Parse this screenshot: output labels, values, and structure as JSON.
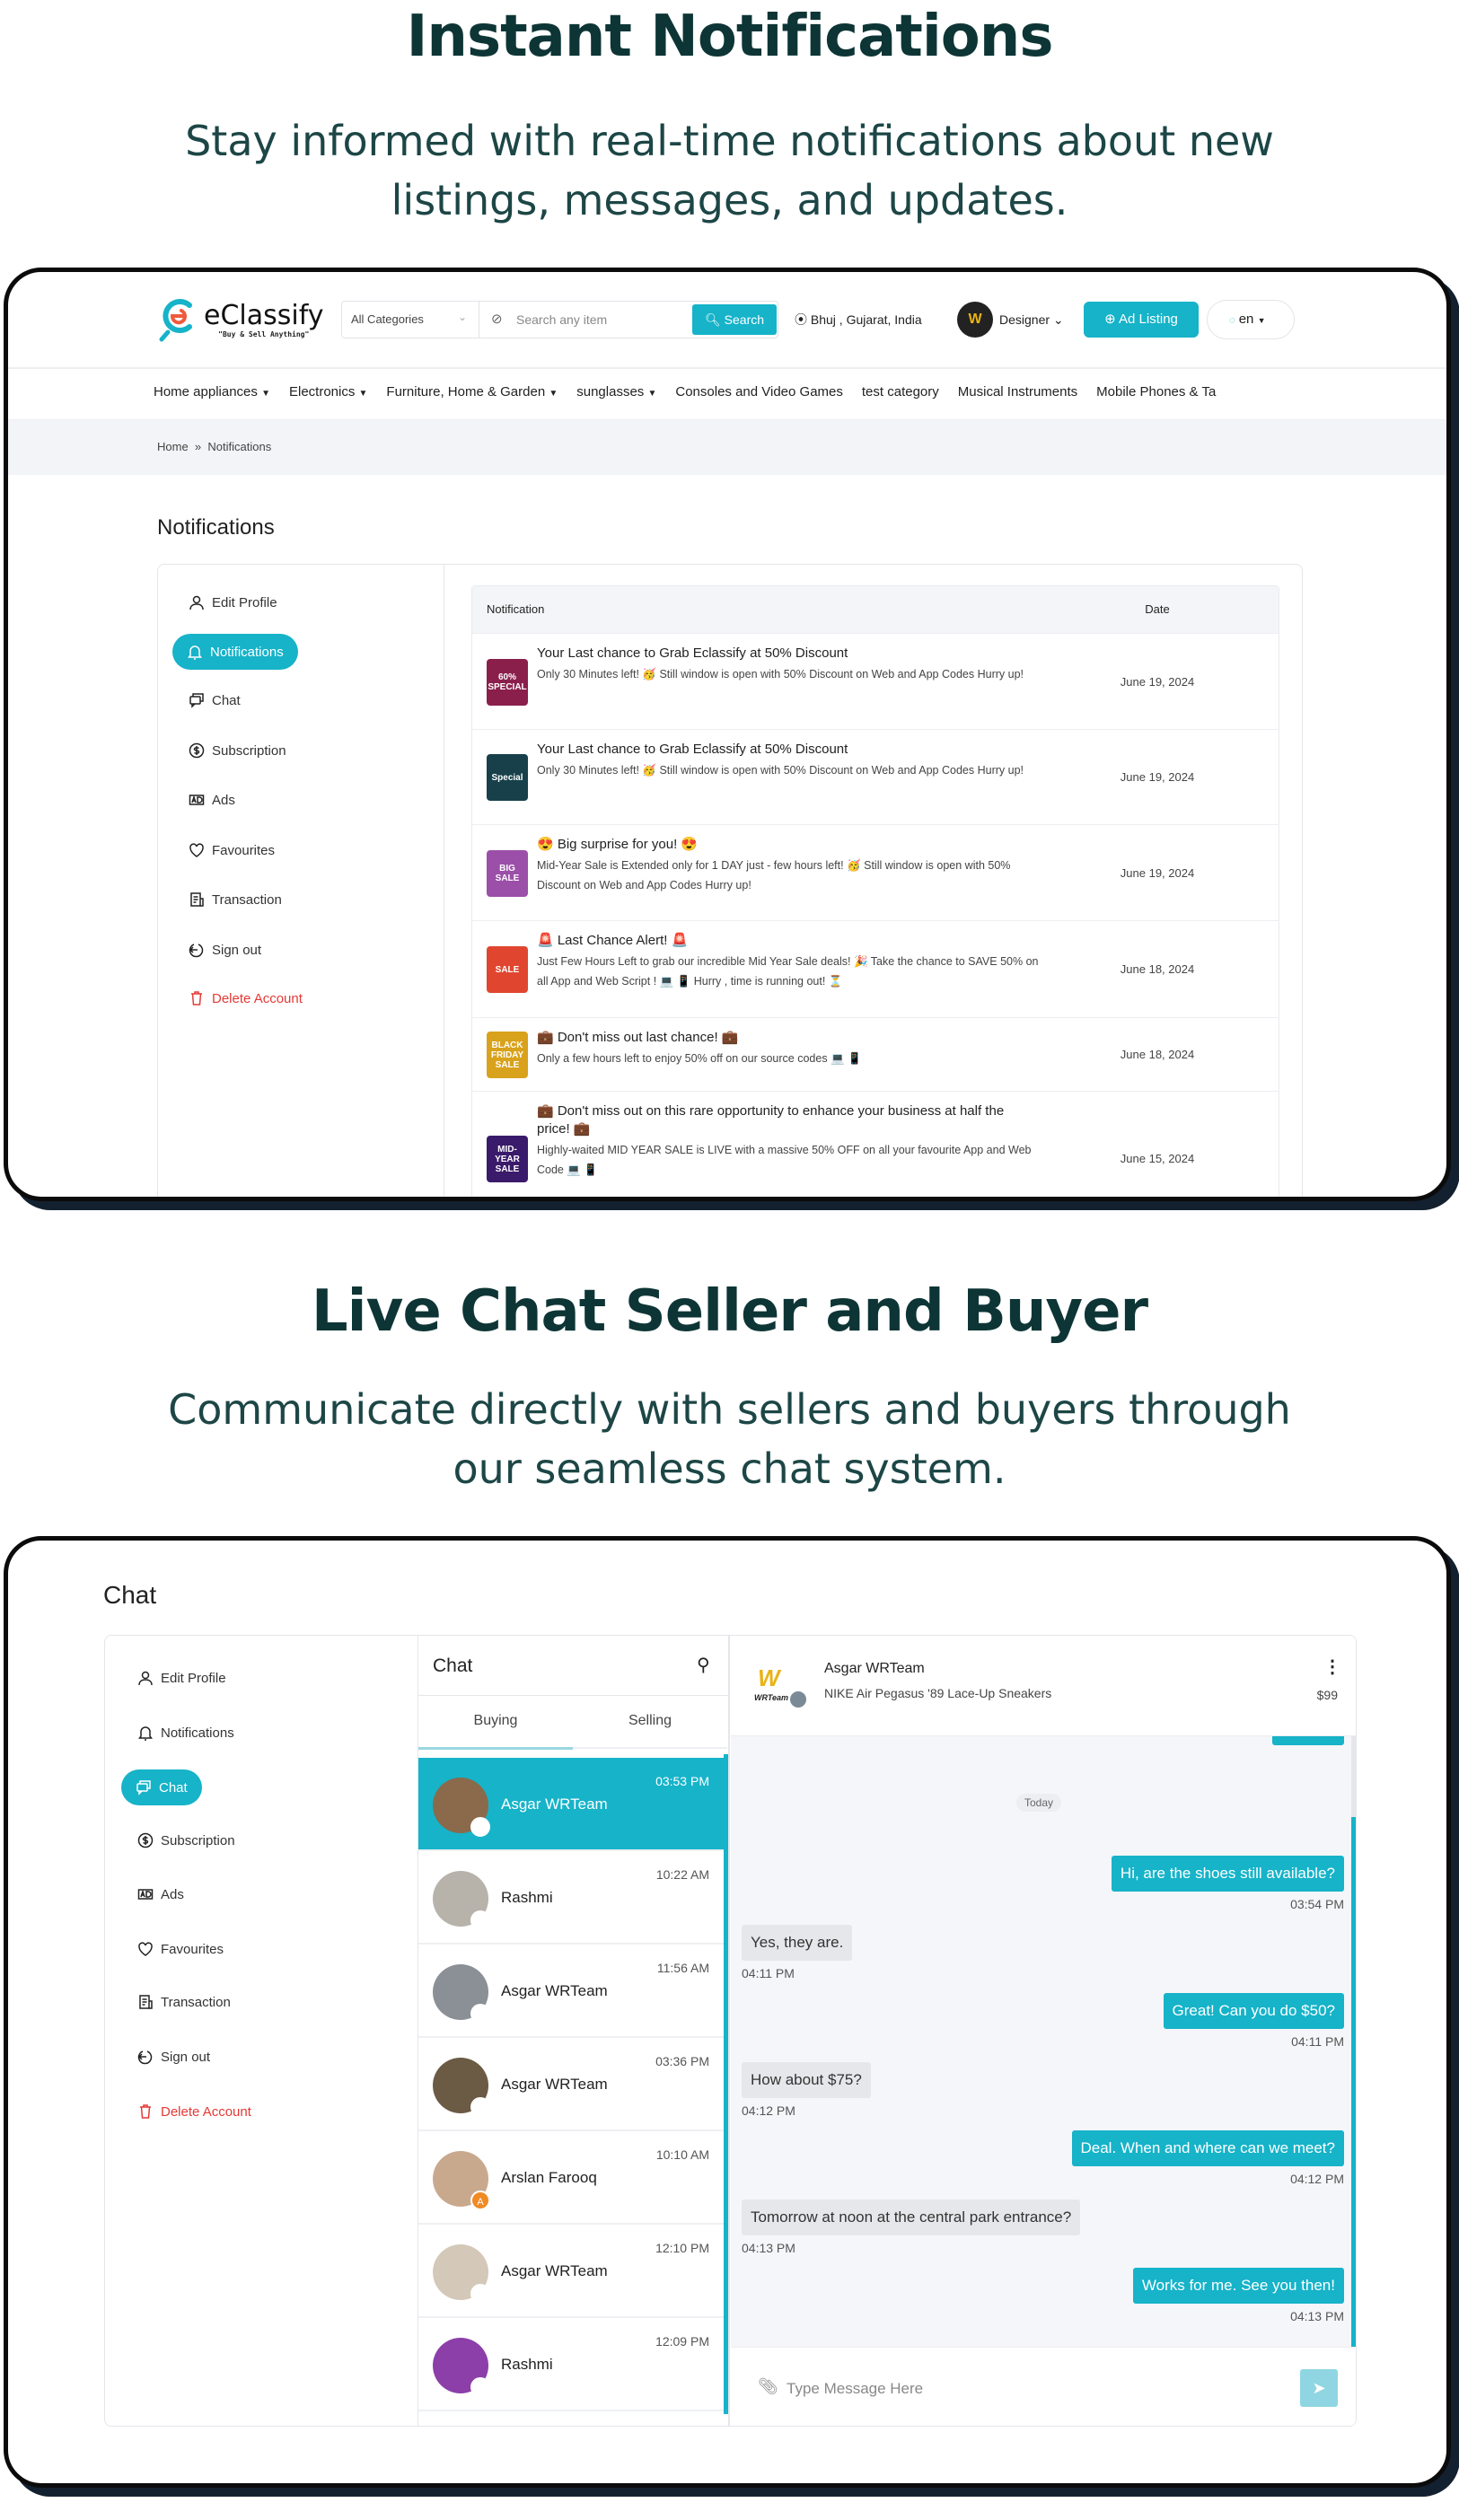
{
  "colors": {
    "accent": "#16b3c9",
    "heading": "#0e3535",
    "danger": "#e53935"
  },
  "section1": {
    "title": "Instant Notifications",
    "subtitle_line1": "Stay informed with real-time notifications about new",
    "subtitle_line2": "listings, messages, and updates."
  },
  "header": {
    "logo_name": "eClassify",
    "logo_tagline": "\"Buy & Sell Anything\"",
    "category_select": "All Categories",
    "search_placeholder": "Search any item",
    "search_button": "Search",
    "location": "Bhuj , Gujarat, India",
    "user_name": "Designer",
    "ad_listing": "Ad Listing",
    "language": "en"
  },
  "nav": [
    "Home appliances",
    "Electronics",
    "Furniture, Home & Garden",
    "sunglasses",
    "Consoles and Video Games",
    "test category",
    "Musical Instruments",
    "Mobile Phones & Ta"
  ],
  "nav_dropdown": [
    true,
    true,
    true,
    true,
    false,
    false,
    false,
    false
  ],
  "breadcrumb": {
    "home": "Home",
    "sep": "»",
    "current": "Notifications"
  },
  "notif_page": {
    "title": "Notifications"
  },
  "sidebar": [
    {
      "label": "Edit Profile",
      "icon": "user-icon"
    },
    {
      "label": "Notifications",
      "icon": "bell-icon"
    },
    {
      "label": "Chat",
      "icon": "chat-icon"
    },
    {
      "label": "Subscription",
      "icon": "dollar-icon"
    },
    {
      "label": "Ads",
      "icon": "ads-icon"
    },
    {
      "label": "Favourites",
      "icon": "heart-icon"
    },
    {
      "label": "Transaction",
      "icon": "receipt-icon"
    },
    {
      "label": "Sign out",
      "icon": "signout-icon"
    },
    {
      "label": "Delete Account",
      "icon": "trash-icon"
    }
  ],
  "table": {
    "col_notification": "Notification",
    "col_date": "Date",
    "rows": [
      {
        "thumb_text": "60% SPECIAL",
        "thumb_color": "#8a1f4c",
        "title": "Your Last chance to Grab Eclassify at 50% Discount",
        "body": "Only 30 Minutes left! 🥳 Still window is open with 50% Discount on Web and App Codes Hurry up!",
        "date": "June 19, 2024"
      },
      {
        "thumb_text": "Special",
        "thumb_color": "#17404a",
        "title": "Your Last chance to Grab Eclassify at 50% Discount",
        "body": "Only 30 Minutes left! 🥳 Still window is open with 50% Discount on Web and App Codes Hurry up!",
        "date": "June 19, 2024"
      },
      {
        "thumb_text": "BIG SALE",
        "thumb_color": "#9b4fa8",
        "title": "😍 Big surprise for you! 😍",
        "body": "Mid-Year Sale is Extended only for 1 DAY just - few hours left! 🥳 Still window is open with 50% Discount on Web and App Codes Hurry up!",
        "date": "June 19, 2024"
      },
      {
        "thumb_text": "SALE",
        "thumb_color": "#e0462f",
        "title": "🚨 Last Chance Alert! 🚨",
        "body": "Just Few Hours Left to grab our incredible Mid Year Sale deals! 🎉 Take the chance to SAVE 50% on all App and Web Script ! 💻 📱 Hurry , time is running out! ⏳",
        "date": "June 18, 2024"
      },
      {
        "thumb_text": "BLACK FRIDAY SALE",
        "thumb_color": "#d9a21c",
        "title": "💼 Don't miss out last chance! 💼",
        "body": "Only a few hours left to enjoy 50% off on our source codes 💻 📱",
        "date": "June 18, 2024"
      },
      {
        "thumb_text": "MID-YEAR SALE",
        "thumb_color": "#3a1a6a",
        "title": "💼 Don't miss out on this rare opportunity to enhance your business at half the price! 💼",
        "body": "Highly-waited MID YEAR SALE is LIVE with a massive 50% OFF on all your favourite App and Web Code 💻 📱",
        "date": "June 15, 2024"
      }
    ]
  },
  "section2": {
    "title": "Live Chat Seller and Buyer",
    "subtitle_line1": "Communicate directly with sellers and buyers through",
    "subtitle_line2": "our seamless chat system."
  },
  "chat_page": {
    "title": "Chat",
    "list_title": "Chat",
    "tab_buying": "Buying",
    "tab_selling": "Selling",
    "active_tab": "Buying",
    "conversations": [
      {
        "name": "Asgar WRTeam",
        "time": "03:53 PM",
        "selected": true,
        "avatar_color": "#8a6a4a"
      },
      {
        "name": "Rashmi",
        "time": "10:22 AM",
        "selected": false,
        "avatar_color": "#b7b2aa"
      },
      {
        "name": "Asgar WRTeam",
        "time": "11:56 AM",
        "selected": false,
        "avatar_color": "#8b8f96"
      },
      {
        "name": "Asgar WRTeam",
        "time": "03:36 PM",
        "selected": false,
        "avatar_color": "#6b5a44"
      },
      {
        "name": "Arslan Farooq",
        "time": "10:10 AM",
        "selected": false,
        "avatar_color": "#c9a98e",
        "badge": "A"
      },
      {
        "name": "Asgar WRTeam",
        "time": "12:10 PM",
        "selected": false,
        "avatar_color": "#d4c8b8"
      },
      {
        "name": "Rashmi",
        "time": "12:09 PM",
        "selected": false,
        "avatar_color": "#8c3fa8"
      }
    ],
    "active": {
      "seller": "Asgar WRTeam",
      "logo_text": "WRTeam",
      "item": "NIKE Air Pegasus '89 Lace-Up Sneakers",
      "price": "$99"
    },
    "day_label": "Today",
    "messages": [
      {
        "from": "me",
        "text": "Hi, are the shoes still available?",
        "time": "03:54 PM"
      },
      {
        "from": "them",
        "text": "Yes, they are.",
        "time": "04:11 PM"
      },
      {
        "from": "me",
        "text": "Great! Can you do $50?",
        "time": "04:11 PM"
      },
      {
        "from": "them",
        "text": "How about $75?",
        "time": "04:12 PM"
      },
      {
        "from": "me",
        "text": "Deal. When and where can we meet?",
        "time": "04:12 PM"
      },
      {
        "from": "them",
        "text": "Tomorrow at noon at the central park entrance?",
        "time": "04:13 PM"
      },
      {
        "from": "me",
        "text": "Works for me. See you then!",
        "time": "04:13 PM"
      }
    ],
    "input_placeholder": "Type Message Here"
  }
}
